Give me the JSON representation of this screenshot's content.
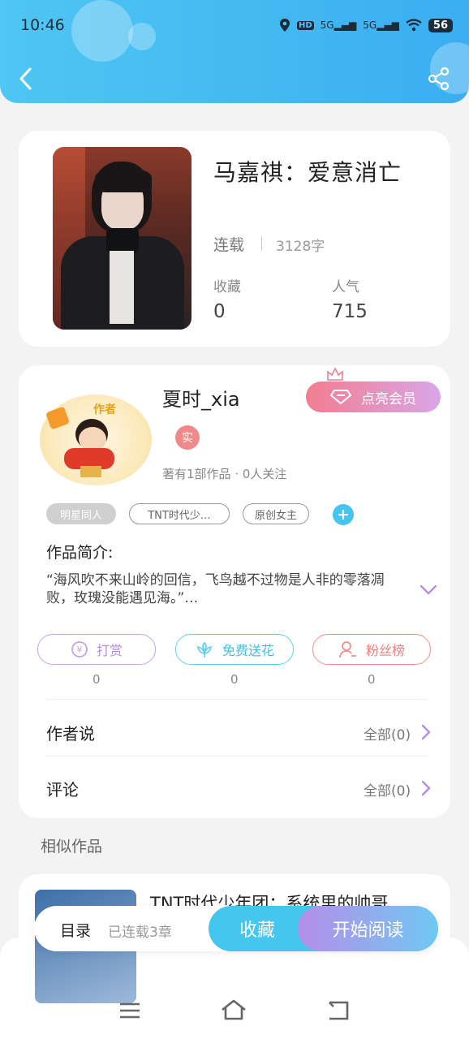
{
  "status": {
    "time": "10:46",
    "signal1": "5G",
    "signal2": "5G",
    "battery": "56"
  },
  "book": {
    "title": "马嘉祺：爱意消亡",
    "status": "连载",
    "word_count": "3128字",
    "favorites_label": "收藏",
    "favorites_value": "0",
    "popularity_label": "人气",
    "popularity_value": "715"
  },
  "author": {
    "name": "夏时_xia",
    "avatar_text": "作者",
    "verified_badge": "实",
    "stats": "著有1部作品 · 0人关注",
    "member_button": "点亮会员",
    "tags": [
      "明星同人",
      "TNT时代少…",
      "原创女主"
    ]
  },
  "intro": {
    "label": "作品简介:",
    "text": "“海风吹不来山岭的回信，飞鸟越不过物是人非的零落凋败，玫瑰没能遇见海。”…"
  },
  "actions": {
    "reward_label": "打赏",
    "reward_count": "0",
    "flower_label": "免费送花",
    "flower_count": "0",
    "fans_label": "粉丝榜",
    "fans_count": "0"
  },
  "author_says": {
    "label": "作者说",
    "right": "全部(0)"
  },
  "comments": {
    "label": "评论",
    "right": "全部(0)"
  },
  "similar": {
    "heading": "相似作品",
    "first_title": "TNT时代少年团：系统里的帅哥"
  },
  "bottom_bar": {
    "toc_label": "目录",
    "chapters": "已连载3章",
    "collect_label": "收藏",
    "read_label": "开始阅读"
  },
  "colors": {
    "accent_blue": "#3fbff0",
    "member_pink": "#ee7e96",
    "purple": "#b58ee8"
  }
}
